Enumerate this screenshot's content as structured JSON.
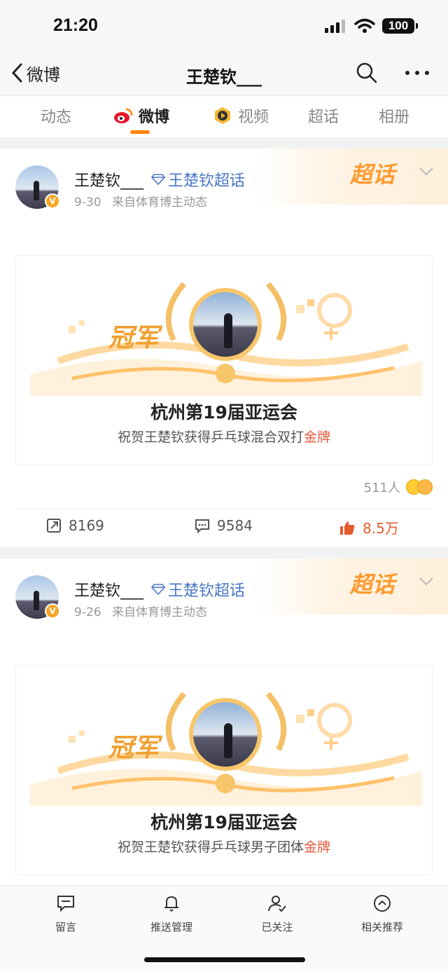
{
  "status": {
    "time": "21:20",
    "battery": "100"
  },
  "nav": {
    "back_label": "微博",
    "title": "王楚钦___"
  },
  "tabs": [
    {
      "label": "动态"
    },
    {
      "label": "微博"
    },
    {
      "label": "视频"
    },
    {
      "label": "超话"
    },
    {
      "label": "相册"
    }
  ],
  "posts": [
    {
      "author": "王楚钦___",
      "super_topic": "王楚钦超话",
      "topic_badge": "超话",
      "date": "9-30",
      "source": "来自体育博主动态",
      "champion_label": "冠军",
      "event_title": "杭州第19届亚运会",
      "subtitle_prefix": "祝贺王楚钦获得乒乓球混合双打",
      "subtitle_highlight": "金牌",
      "reactions_count": "511人",
      "reposts": "8169",
      "comments": "9584",
      "likes": "8.5万"
    },
    {
      "author": "王楚钦___",
      "super_topic": "王楚钦超话",
      "topic_badge": "超话",
      "date": "9-26",
      "source": "来自体育博主动态",
      "champion_label": "冠军",
      "event_title": "杭州第19届亚运会",
      "subtitle_prefix": "祝贺王楚钦获得乒乓球男子团体",
      "subtitle_highlight": "金牌"
    }
  ],
  "bottom_bar": [
    {
      "label": "留言"
    },
    {
      "label": "推送管理"
    },
    {
      "label": "已关注"
    },
    {
      "label": "相关推荐"
    }
  ],
  "colors": {
    "accent": "#ff8200",
    "link": "#4a77c4",
    "like": "#e55b2c",
    "gold": "#f0a030"
  }
}
